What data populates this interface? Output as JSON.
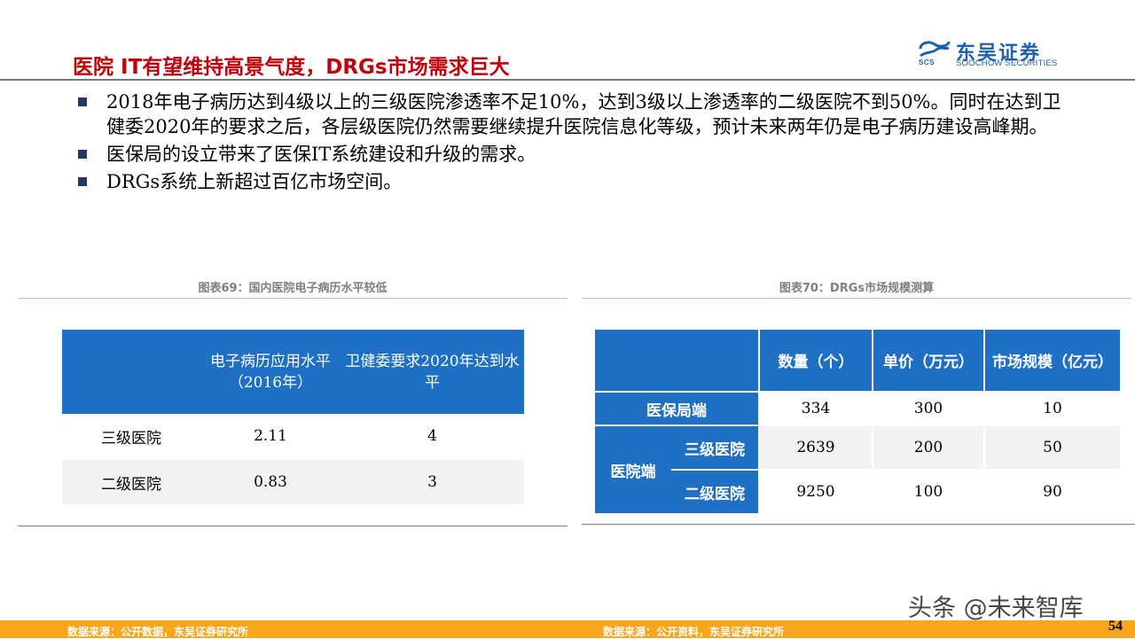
{
  "header": {
    "title": "医院 IT有望维持高景气度，DRGs市场需求巨大",
    "logo_cn": "东吴证券",
    "logo_en": "SOOCHOW SECURITIES",
    "logo_abbr": "SCS"
  },
  "bullets": [
    "2018年电子病历达到4级以上的三级医院渗透率不足10%，达到3级以上渗透率的二级医院不到50%。同时在达到卫健委2020年的要求之后，各层级医院仍然需要继续提升医院信息化等级，预计未来两年仍是电子病历建设高峰期。",
    "医保局的设立带来了医保IT系统建设和升级的需求。",
    "DRGs系统上新超过百亿市场空间。"
  ],
  "table1": {
    "caption": "图表69：国内医院电子病历水平较低",
    "headers": [
      "",
      "电子病历应用水平（2016年）",
      "卫健委要求2020年达到水平"
    ],
    "rows": [
      [
        "三级医院",
        "2.11",
        "4"
      ],
      [
        "二级医院",
        "0.83",
        "3"
      ]
    ],
    "source": "数据来源：公开数据，东吴证券研究所"
  },
  "table2": {
    "caption": "图表70：DRGs市场规模测算",
    "headers": [
      "",
      "数量（个）",
      "单价（万元）",
      "市场规模（亿元）"
    ],
    "row_insurance": {
      "label": "医保局端",
      "values": [
        "334",
        "300",
        "10"
      ]
    },
    "hospital_group": "医院端",
    "row_tier3": {
      "label": "三级医院",
      "values": [
        "2639",
        "200",
        "50"
      ]
    },
    "row_tier2": {
      "label": "二级医院",
      "values": [
        "9250",
        "100",
        "90"
      ]
    },
    "source": "数据来源：公开资料，东吴证券研究所"
  },
  "footer": {
    "page_number": "54",
    "watermark": "头条 @未来智库"
  },
  "colors": {
    "title_red": "#c0000b",
    "table_blue": "#1f6fc5",
    "footer_orange": "#f7a51d",
    "bullet_navy": "#1f3a63"
  }
}
